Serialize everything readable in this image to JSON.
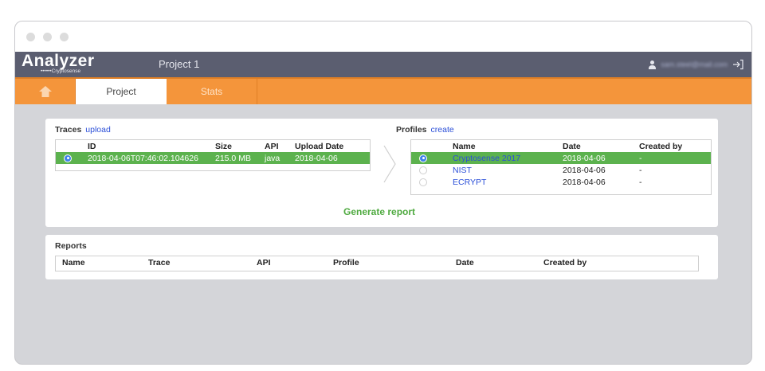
{
  "app": {
    "logo_text": "Analyzer",
    "logo_sub_dots": "••••••",
    "logo_sub_text": "Cryptosense",
    "project_title": "Project 1",
    "user_email": "sam.steel@mail.com"
  },
  "nav": {
    "tabs": [
      {
        "label": "Project",
        "active": true
      },
      {
        "label": "Stats",
        "active": false
      }
    ]
  },
  "traces": {
    "title": "Traces",
    "action": "upload",
    "columns": [
      "",
      "ID",
      "Size",
      "API",
      "Upload Date"
    ],
    "rows": [
      {
        "selected": true,
        "id": "2018-04-06T07:46:02.104626",
        "size": "215.0 MB",
        "api": "java",
        "upload_date": "2018-04-06"
      }
    ]
  },
  "profiles": {
    "title": "Profiles",
    "action": "create",
    "columns": [
      "",
      "Name",
      "Date",
      "Created by"
    ],
    "rows": [
      {
        "selected": true,
        "name": "Cryptosense 2017",
        "date": "2018-04-06",
        "created_by": "-"
      },
      {
        "selected": false,
        "name": "NIST",
        "date": "2018-04-06",
        "created_by": "-"
      },
      {
        "selected": false,
        "name": "ECRYPT",
        "date": "2018-04-06",
        "created_by": "-"
      }
    ]
  },
  "generate_label": "Generate report",
  "reports": {
    "title": "Reports",
    "columns": [
      "Name",
      "Trace",
      "API",
      "Profile",
      "Date",
      "Created by"
    ]
  },
  "colors": {
    "appbar": "#5b5e70",
    "navbar": "#f4953b",
    "selected_row": "#5cb24e",
    "link": "#2b4fd8",
    "generate": "#4faa40"
  },
  "icons": [
    "home-icon",
    "user-icon",
    "logout-icon",
    "chevron-right-icon",
    "radio-icon"
  ]
}
